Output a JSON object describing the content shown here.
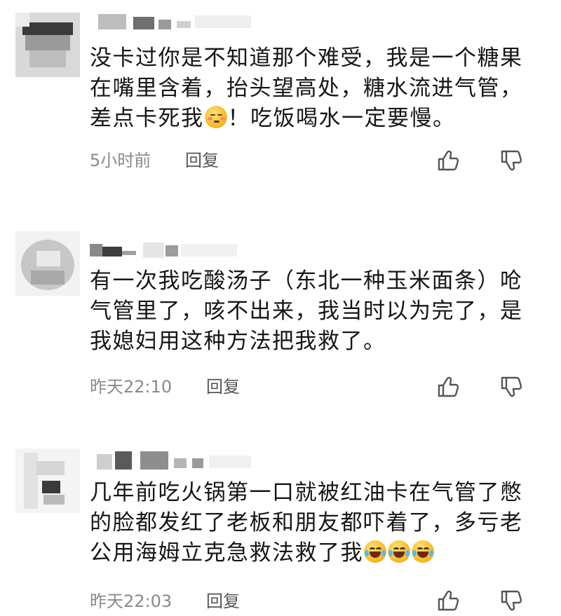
{
  "comments": [
    {
      "text_before": "没卡过你是不知道那个难受，我是一个糖果在嘴里含着，抬头望高处，糖水流进气管，差点卡死我",
      "emoji": "shy-face-icon",
      "text_after": "！吃饭喝水一定要慢。",
      "time": "5小时前",
      "reply": "回复"
    },
    {
      "text_before": "有一次我吃酸汤子（东北一种玉米面条）呛气管里了，咳不出来，我当时以为完了，是我媳妇用这种方法把我救了。",
      "emoji": "",
      "text_after": "",
      "time": "昨天22:10",
      "reply": "回复"
    },
    {
      "text_before": "几年前吃火锅第一口就被红油卡在气管了憋的脸都发红了老板和朋友都吓着了，多亏老公用海姆立克急救法救了我",
      "emoji": "laughing-crying-face-icon",
      "emoji_count": 3,
      "text_after": "",
      "time": "昨天22:03",
      "reply": "回复"
    }
  ],
  "icons": {
    "like": "thumbs-up-icon",
    "dislike": "thumbs-down-icon"
  },
  "colors": {
    "text": "#161616",
    "meta": "#8a8a8a",
    "icon": "#555555"
  }
}
